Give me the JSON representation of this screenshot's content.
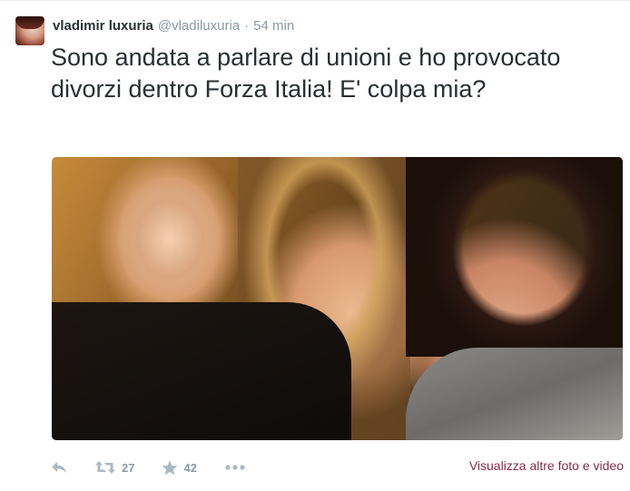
{
  "tweet": {
    "fullname": "vladimir luxuria",
    "username": "@vladiluxuria",
    "separator": "·",
    "time": "54 min",
    "text": "Sono andata a parlare di unioni e ho provocato divorzi dentro Forza Italia! E' colpa mia?",
    "avatar_icon": "profile-photo"
  },
  "actions": {
    "reply_icon": "reply-icon",
    "retweet_icon": "retweet-icon",
    "retweet_count": "27",
    "favorite_icon": "star-icon",
    "favorite_count": "42",
    "more_icon": "more-icon"
  },
  "media_link": "Visualizza altre foto e video",
  "colors": {
    "name": "#292f33",
    "meta": "#8899a6",
    "action": "#8899a6",
    "link": "#8b2b45"
  }
}
